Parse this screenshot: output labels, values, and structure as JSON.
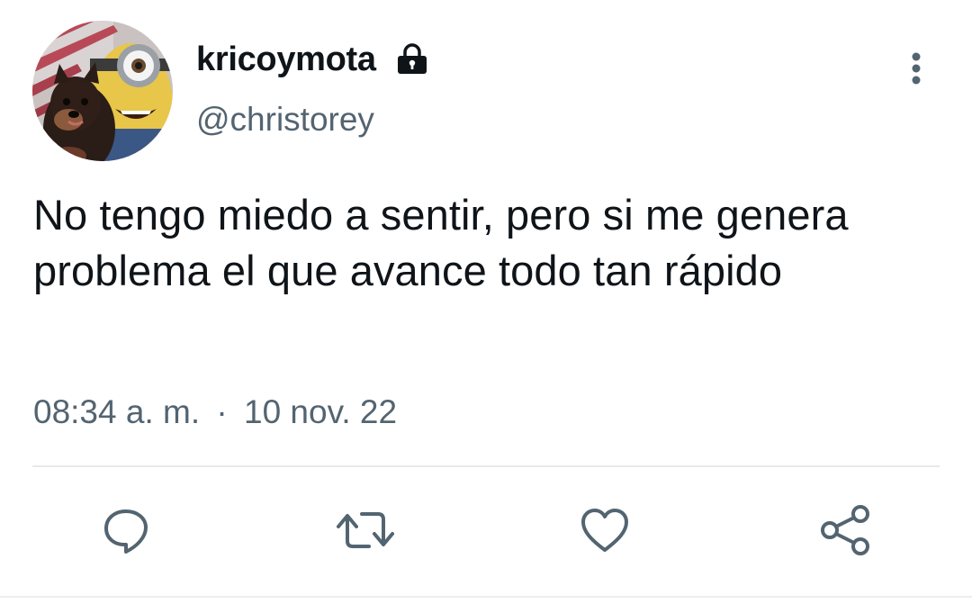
{
  "author": {
    "display_name": "kricoymota",
    "handle": "@christorey",
    "avatar_icon": "avatar-photo",
    "protected_icon": "lock-icon"
  },
  "tweet": {
    "text": "No tengo miedo a sentir, pero si me genera problema el que avance todo tan rápido",
    "time": "08:34 a. m.",
    "separator": "·",
    "date": "10 nov. 22"
  },
  "actions": [
    {
      "name": "reply",
      "icon": "reply-icon"
    },
    {
      "name": "retweet",
      "icon": "retweet-icon"
    },
    {
      "name": "like",
      "icon": "heart-icon"
    },
    {
      "name": "share",
      "icon": "share-icon"
    }
  ],
  "colors": {
    "text_primary": "#0f1419",
    "text_secondary": "#536471",
    "divider": "#e7eaed"
  }
}
